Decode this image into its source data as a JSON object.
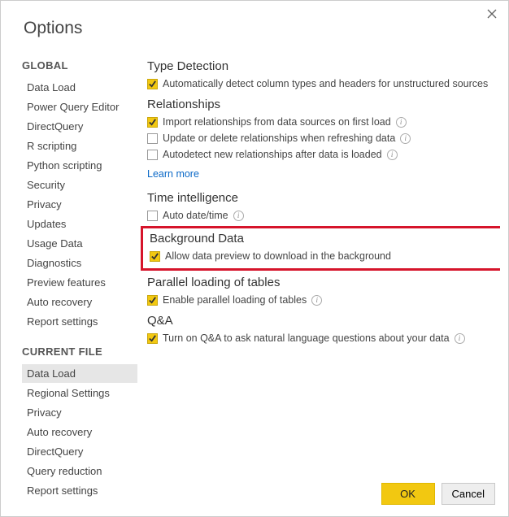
{
  "window": {
    "title": "Options"
  },
  "sidebar": {
    "global_header": "GLOBAL",
    "global_items": [
      "Data Load",
      "Power Query Editor",
      "DirectQuery",
      "R scripting",
      "Python scripting",
      "Security",
      "Privacy",
      "Updates",
      "Usage Data",
      "Diagnostics",
      "Preview features",
      "Auto recovery",
      "Report settings"
    ],
    "current_header": "CURRENT FILE",
    "current_items": [
      "Data Load",
      "Regional Settings",
      "Privacy",
      "Auto recovery",
      "DirectQuery",
      "Query reduction",
      "Report settings"
    ],
    "current_selected_index": 0
  },
  "main": {
    "type_detection": {
      "title": "Type Detection",
      "opt1": {
        "label": "Automatically detect column types and headers for unstructured sources",
        "checked": true
      }
    },
    "relationships": {
      "title": "Relationships",
      "opt1": {
        "label": "Import relationships from data sources on first load",
        "checked": true,
        "info": true
      },
      "opt2": {
        "label": "Update or delete relationships when refreshing data",
        "checked": false,
        "info": true
      },
      "opt3": {
        "label": "Autodetect new relationships after data is loaded",
        "checked": false,
        "info": true
      },
      "learn_more": "Learn more"
    },
    "time_intelligence": {
      "title": "Time intelligence",
      "opt1": {
        "label": "Auto date/time",
        "checked": false,
        "info": true
      }
    },
    "background_data": {
      "title": "Background Data",
      "opt1": {
        "label": "Allow data preview to download in the background",
        "checked": true
      }
    },
    "parallel": {
      "title": "Parallel loading of tables",
      "opt1": {
        "label": "Enable parallel loading of tables",
        "checked": true,
        "info": true
      }
    },
    "qa": {
      "title": "Q&A",
      "opt1": {
        "label": "Turn on Q&A to ask natural language questions about your data",
        "checked": true,
        "info": true
      }
    }
  },
  "footer": {
    "ok": "OK",
    "cancel": "Cancel"
  }
}
